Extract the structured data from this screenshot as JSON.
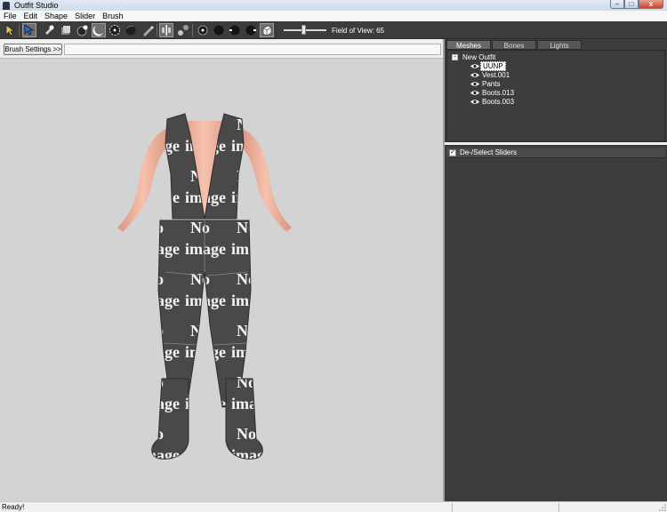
{
  "window": {
    "title": "Outfit Studio",
    "min_symbol": "–",
    "max_symbol": "□",
    "close_symbol": "x"
  },
  "menu": [
    "File",
    "Edit",
    "Shape",
    "Slider",
    "Brush"
  ],
  "toolbar": {
    "icons": [
      "select-tool-icon",
      "move-tool-icon",
      "brush-inflate-icon",
      "brush-deflate-icon",
      "brush-move-icon",
      "brush-smooth-icon",
      "brush-mask-icon",
      "brush-unmask-icon",
      "brush-weight-icon",
      "eyedropper-icon",
      "toggle-mirror-icon",
      "toggle-connected-icon",
      "view-front-icon",
      "view-back-icon",
      "view-left-icon",
      "view-right-icon",
      "perspective-toggle-icon"
    ],
    "fov_label": "Field of View: 65",
    "fov_value": 65
  },
  "left_panel": {
    "brush_settings_label": "Brush Settings >>"
  },
  "right_panel": {
    "tabs": [
      "Meshes",
      "Bones",
      "Lights"
    ],
    "selected_tab": "Meshes",
    "tree": {
      "root": "New Outfit",
      "root_toggle": "-",
      "meshes": [
        {
          "name": "UUNP",
          "selected": true
        },
        {
          "name": "Vest.001",
          "selected": false
        },
        {
          "name": "Pants",
          "selected": false
        },
        {
          "name": "Boots.013",
          "selected": false
        },
        {
          "name": "Boots.003",
          "selected": false
        }
      ]
    },
    "sliders_header": "De-/Select Sliders",
    "sliders_checked": true,
    "check_mark": "✓"
  },
  "viewport": {
    "texture_text": [
      "No",
      "image"
    ]
  },
  "status": {
    "text": "Ready!"
  },
  "colors": {
    "viewport_bg": "#d3d3d3",
    "panel_dark": "#3c3c3c",
    "outfit": "#4a4848",
    "skin": "#efb39e"
  }
}
